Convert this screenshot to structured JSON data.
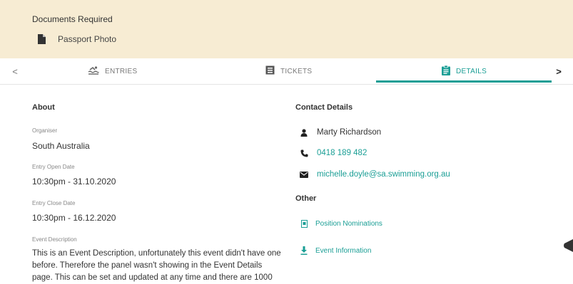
{
  "documents": {
    "title": "Documents Required",
    "items": [
      {
        "label": "Passport Photo",
        "icon": "file-icon"
      }
    ]
  },
  "tabs": {
    "prev_label": "<",
    "next_label": ">",
    "items": [
      {
        "label": "ENTRIES",
        "icon": "swimmer-icon",
        "active": false
      },
      {
        "label": "TICKETS",
        "icon": "ticket-icon",
        "active": false
      },
      {
        "label": "DETAILS",
        "icon": "clipboard-icon",
        "active": true
      }
    ]
  },
  "about": {
    "title": "About",
    "organiser_label": "Organiser",
    "organiser_value": "South Australia",
    "open_label": "Entry Open Date",
    "open_value": "10:30pm - 31.10.2020",
    "close_label": "Entry Close Date",
    "close_value": "10:30pm - 16.12.2020",
    "description_label": "Event Description",
    "description": "This is an Event Description, unfortunately this event didn't have one before. Therefore the panel wasn't showing in the Event Details page. This can be set and updated at any time and there are 1000"
  },
  "contact": {
    "title": "Contact Details",
    "name": "Marty Richardson",
    "phone": "0418 189 482",
    "email": "michelle.doyle@sa.swimming.org.au"
  },
  "other": {
    "title": "Other",
    "links": [
      {
        "label": "Position Nominations",
        "icon": "document-icon"
      },
      {
        "label": "Event Information",
        "icon": "download-icon"
      }
    ]
  },
  "colors": {
    "accent": "#1a9e95",
    "banner": "#f7ecd3"
  }
}
